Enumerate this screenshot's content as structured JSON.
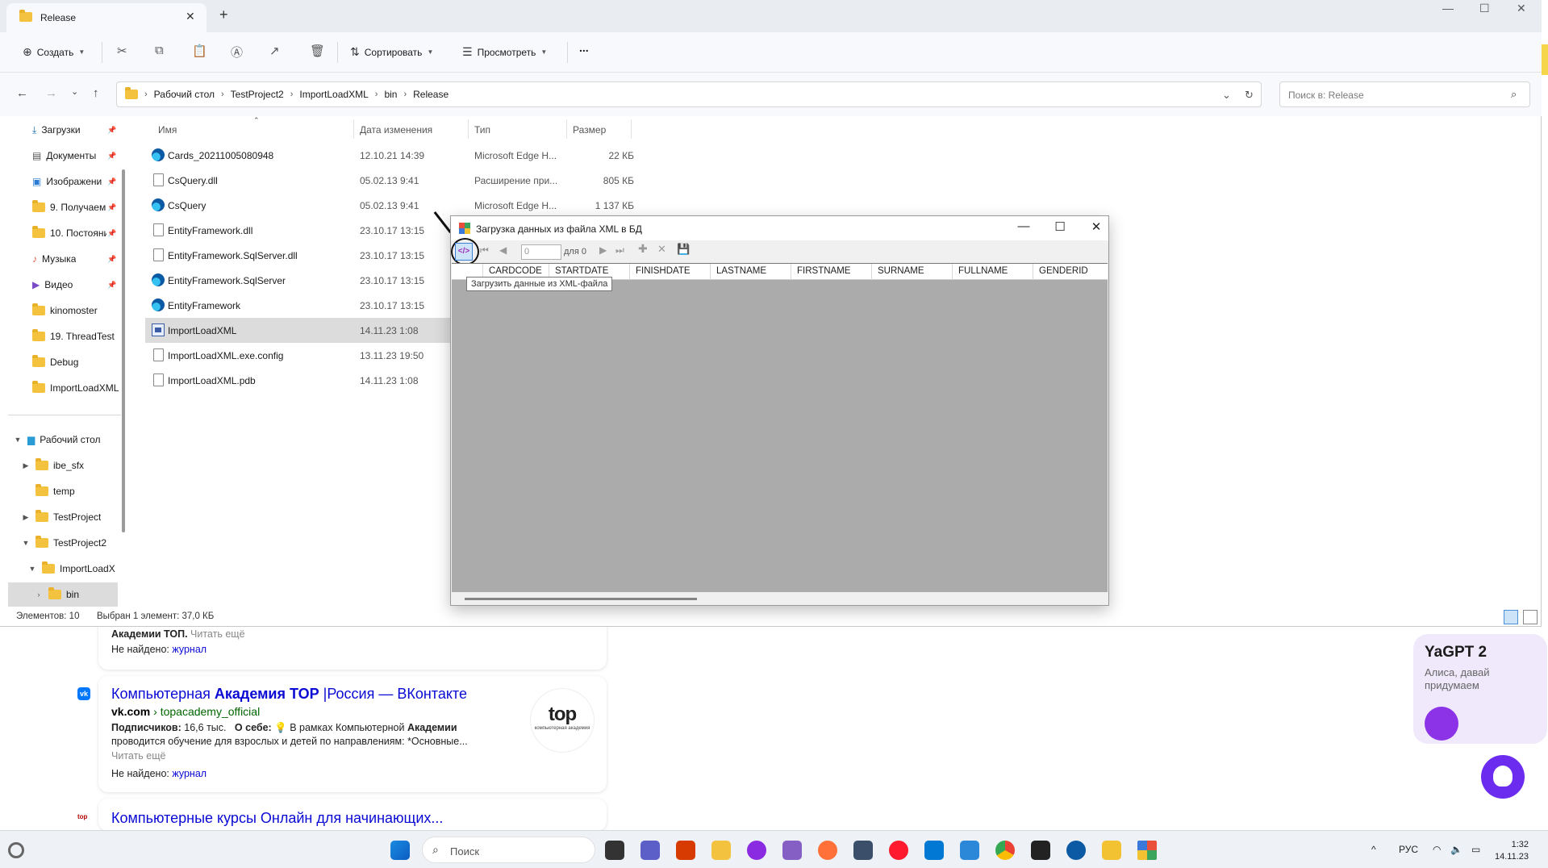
{
  "browser": {
    "snippet_top": {
      "bold": "Академии ТОП.",
      "more": "Читать ещё",
      "notfound_label": "Не найдено:",
      "notfound_word": "журнал"
    },
    "result1": {
      "title_a": "Компьютерная ",
      "title_b": "Академия TOP",
      "title_c": " |Россия — ВКонтакте",
      "host": "vk.com",
      "path": "topacademy_official",
      "subs_label": "Подписчиков:",
      "subs_value": "16,6 тыс.",
      "about_label": "О себе:",
      "text_a": "В рамках Компьютерной ",
      "text_b": "Академии",
      "text_c": "проводится обучение для взрослых и детей по направлениям: *Основные...",
      "more": "Читать ещё",
      "notfound_label": "Не найдено:",
      "notfound_word": "журнал",
      "logo_main": "top",
      "logo_sub": "компьютерная академия"
    },
    "result2": {
      "title": "Компьютерные курсы Онлайн для начинающих..."
    },
    "yagpt": {
      "title": "YaGPT 2",
      "subtitle": "Алиса, давай придумаем"
    }
  },
  "explorer": {
    "tab_title": "Release",
    "toolbar": {
      "create": "Создать",
      "sort": "Сортировать",
      "view": "Просмотреть",
      "more": "..."
    },
    "breadcrumbs": [
      "Рабочий стол",
      "TestProject2",
      "ImportLoadXML",
      "bin",
      "Release"
    ],
    "search_placeholder": "Поиск в: Release",
    "quick_access": [
      {
        "label": "Загрузки"
      },
      {
        "label": "Документы"
      },
      {
        "label": "Изображени"
      },
      {
        "label": "9. Получаем"
      },
      {
        "label": "10. Постояни"
      },
      {
        "label": "Музыка"
      },
      {
        "label": "Видео"
      },
      {
        "label": "kinomoster"
      },
      {
        "label": "19. ThreadTest"
      },
      {
        "label": "Debug"
      },
      {
        "label": "ImportLoadXML"
      }
    ],
    "tree": [
      {
        "label": "Рабочий стол"
      },
      {
        "label": "ibe_sfx"
      },
      {
        "label": "temp"
      },
      {
        "label": "TestProject"
      },
      {
        "label": "TestProject2"
      },
      {
        "label": "ImportLoadX"
      },
      {
        "label": "bin"
      }
    ],
    "columns": {
      "name": "Имя",
      "date": "Дата изменения",
      "type": "Тип",
      "size": "Размер"
    },
    "files": [
      {
        "name": "Cards_20211005080948",
        "date": "12.10.21 14:39",
        "type": "Microsoft Edge H...",
        "size": "22 КБ"
      },
      {
        "name": "CsQuery.dll",
        "date": "05.02.13 9:41",
        "type": "Расширение при...",
        "size": "805 КБ"
      },
      {
        "name": "CsQuery",
        "date": "05.02.13 9:41",
        "type": "Microsoft Edge H...",
        "size": "1 137 КБ"
      },
      {
        "name": "EntityFramework.dll",
        "date": "23.10.17 13:15",
        "type": "",
        "size": ""
      },
      {
        "name": "EntityFramework.SqlServer.dll",
        "date": "23.10.17 13:15",
        "type": "",
        "size": ""
      },
      {
        "name": "EntityFramework.SqlServer",
        "date": "23.10.17 13:15",
        "type": "",
        "size": ""
      },
      {
        "name": "EntityFramework",
        "date": "23.10.17 13:15",
        "type": "",
        "size": ""
      },
      {
        "name": "ImportLoadXML",
        "date": "14.11.23 1:08",
        "type": "",
        "size": ""
      },
      {
        "name": "ImportLoadXML.exe.config",
        "date": "13.11.23 19:50",
        "type": "",
        "size": ""
      },
      {
        "name": "ImportLoadXML.pdb",
        "date": "14.11.23 1:08",
        "type": "",
        "size": ""
      }
    ],
    "status": {
      "count": "Элементов: 10",
      "selected": "Выбран 1 элемент: 37,0 КБ"
    }
  },
  "dialog": {
    "title": "Загрузка данных из файла XML в БД",
    "position_value": "0",
    "count_label": "для 0",
    "tooltip": "Загрузить данные из XML-файла",
    "columns": [
      "CARDCODE",
      "STARTDATE",
      "FINISHDATE",
      "LASTNAME",
      "FIRSTNAME",
      "SURNAME",
      "FULLNAME",
      "GENDERID"
    ]
  },
  "taskbar": {
    "search_label": "Поиск",
    "lang": "РУС",
    "time": "1:32",
    "date": "14.11.23"
  }
}
